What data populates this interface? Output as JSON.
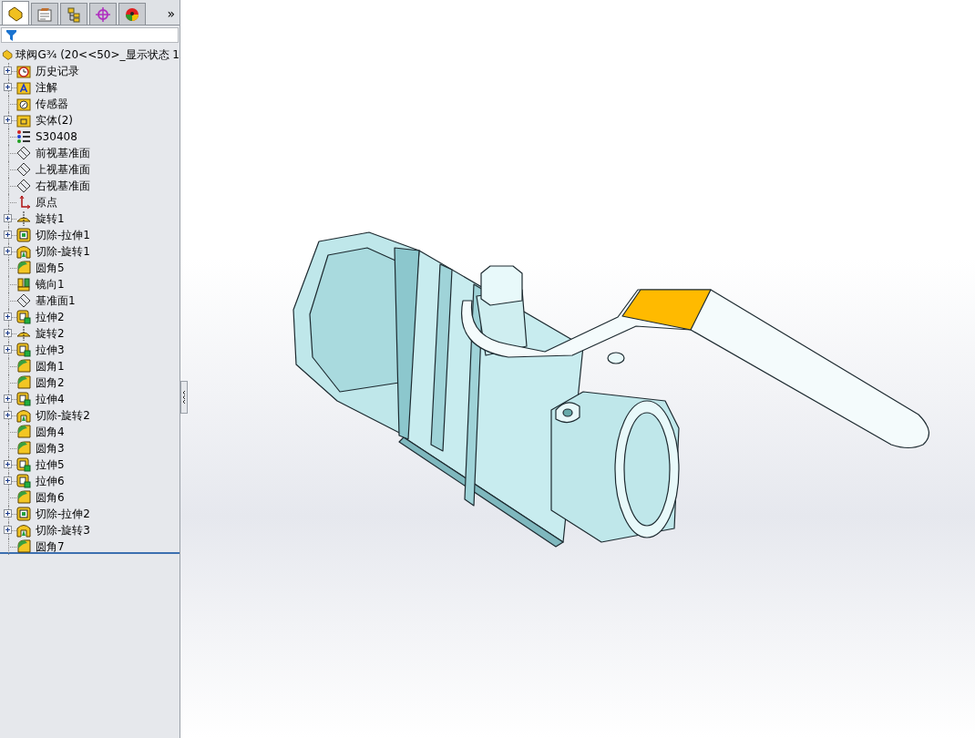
{
  "panel_tabs": [
    {
      "kind": "feature-tree",
      "selected": true
    },
    {
      "kind": "property",
      "selected": false
    },
    {
      "kind": "configuration",
      "selected": false
    },
    {
      "kind": "dimxpert",
      "selected": false
    },
    {
      "kind": "display",
      "selected": false
    }
  ],
  "more_tabs": "»",
  "tree": {
    "root": "球阀G¾  (20<<50>_显示状态 1",
    "items": [
      {
        "label": "历史记录",
        "kind": "history",
        "collapsed": true
      },
      {
        "label": "注解",
        "kind": "annotation",
        "collapsed": true
      },
      {
        "label": "传感器",
        "kind": "sensor",
        "collapsed": false
      },
      {
        "label": "实体(2)",
        "kind": "solid",
        "collapsed": true
      },
      {
        "label": "S30408",
        "kind": "material",
        "collapsed": false
      },
      {
        "label": "前视基准面",
        "kind": "plane",
        "collapsed": false
      },
      {
        "label": "上视基准面",
        "kind": "plane",
        "collapsed": false
      },
      {
        "label": "右视基准面",
        "kind": "plane",
        "collapsed": false
      },
      {
        "label": "原点",
        "kind": "origin",
        "collapsed": false
      },
      {
        "label": "旋转1",
        "kind": "revolve",
        "collapsed": true
      },
      {
        "label": "切除-拉伸1",
        "kind": "cut-extrude",
        "collapsed": true
      },
      {
        "label": "切除-旋转1",
        "kind": "cut-revolve",
        "collapsed": true
      },
      {
        "label": "圆角5",
        "kind": "fillet",
        "collapsed": false
      },
      {
        "label": "镜向1",
        "kind": "mirror",
        "collapsed": false
      },
      {
        "label": "基准面1",
        "kind": "plane",
        "collapsed": false
      },
      {
        "label": "拉伸2",
        "kind": "extrude",
        "collapsed": true
      },
      {
        "label": "旋转2",
        "kind": "revolve",
        "collapsed": true
      },
      {
        "label": "拉伸3",
        "kind": "extrude",
        "collapsed": true
      },
      {
        "label": "圆角1",
        "kind": "fillet",
        "collapsed": false
      },
      {
        "label": "圆角2",
        "kind": "fillet",
        "collapsed": false
      },
      {
        "label": "拉伸4",
        "kind": "extrude",
        "collapsed": true
      },
      {
        "label": "切除-旋转2",
        "kind": "cut-revolve",
        "collapsed": true
      },
      {
        "label": "圆角4",
        "kind": "fillet",
        "collapsed": false
      },
      {
        "label": "圆角3",
        "kind": "fillet",
        "collapsed": false
      },
      {
        "label": "拉伸5",
        "kind": "extrude",
        "collapsed": true
      },
      {
        "label": "拉伸6",
        "kind": "extrude",
        "collapsed": true
      },
      {
        "label": "圆角6",
        "kind": "fillet",
        "collapsed": false
      },
      {
        "label": "切除-拉伸2",
        "kind": "cut-extrude",
        "collapsed": true
      },
      {
        "label": "切除-旋转3",
        "kind": "cut-revolve",
        "collapsed": true
      },
      {
        "label": "圆角7",
        "kind": "fillet",
        "collapsed": false
      }
    ]
  }
}
